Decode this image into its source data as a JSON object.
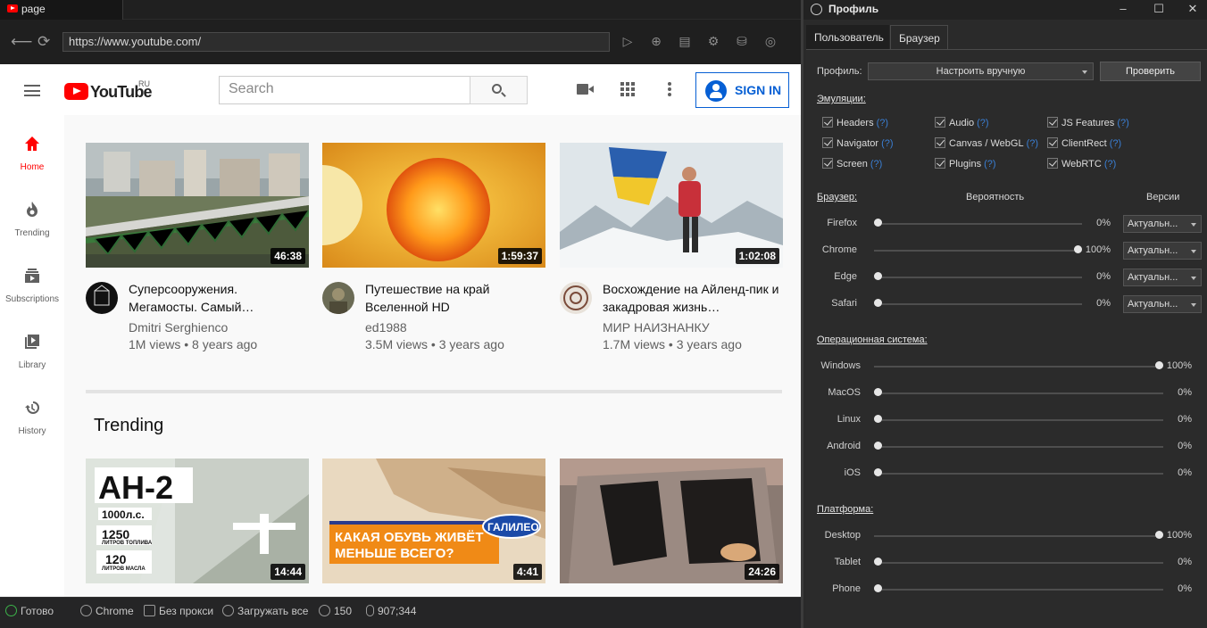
{
  "browser": {
    "tab_title": "page",
    "url": "https://www.youtube.com/"
  },
  "youtube": {
    "logo_text": "YouTube",
    "region": "RU",
    "search_placeholder": "Search",
    "sign_in": "SIGN IN",
    "guide": [
      "Home",
      "Trending",
      "Subscriptions",
      "Library",
      "History"
    ],
    "videos": [
      {
        "title": "Суперсооружения. Мегамосты. Самый…",
        "channel": "Dmitri Serghienco",
        "meta": "1M views • 8 years ago",
        "duration": "46:38"
      },
      {
        "title": "Путешествие на край Вселенной HD",
        "channel": "ed1988",
        "meta": "3.5M views • 3 years ago",
        "duration": "1:59:37"
      },
      {
        "title": "Восхождение на Айленд-пик и закадровая жизнь…",
        "channel": "МИР НАИЗНАНКУ",
        "meta": "1.7M views • 3 years ago",
        "duration": "1:02:08"
      }
    ],
    "trending_title": "Trending",
    "trending": [
      {
        "duration": "14:44",
        "overlay": [
          "АН-2",
          "1000л.с.",
          "1250",
          "ЛИТРОВ ТОПЛИВА",
          "120",
          "ЛИТРОВ МАСЛА"
        ]
      },
      {
        "duration": "4:41",
        "overlay": [
          "КАКАЯ ОБУВЬ ЖИВЁТ",
          "МЕНЬШЕ ВСЕГО?",
          "ГАЛИЛЕО"
        ]
      },
      {
        "duration": "24:26",
        "overlay": []
      }
    ]
  },
  "statusbar": {
    "state": "Готово",
    "browser": "Chrome",
    "proxy": "Без прокси",
    "load": "Загружать все",
    "count": "150",
    "coords": "907;344"
  },
  "panel": {
    "title": "Профиль",
    "tabs": [
      "Пользователь",
      "Браузер"
    ],
    "profile_label": "Профиль:",
    "profile_value": "Настроить вручную",
    "check_button": "Проверить",
    "emulation_label": "Эмуляции:",
    "emulations": [
      {
        "label": "Headers",
        "q": "(?)"
      },
      {
        "label": "Audio",
        "q": "(?)"
      },
      {
        "label": "JS Features",
        "q": "(?)"
      },
      {
        "label": "Navigator",
        "q": "(?)"
      },
      {
        "label": "Canvas / WebGL",
        "q": "(?)"
      },
      {
        "label": "ClientRect",
        "q": "(?)"
      },
      {
        "label": "Screen",
        "q": "(?)"
      },
      {
        "label": "Plugins",
        "q": "(?)"
      },
      {
        "label": "WebRTC",
        "q": "(?)"
      }
    ],
    "browser_label": "Браузер:",
    "probability_label": "Вероятность",
    "versions_label": "Версии",
    "browsers": [
      {
        "name": "Firefox",
        "value": 0,
        "pct": "0%",
        "version": "Актуальн..."
      },
      {
        "name": "Chrome",
        "value": 100,
        "pct": "100%",
        "version": "Актуальн..."
      },
      {
        "name": "Edge",
        "value": 0,
        "pct": "0%",
        "version": "Актуальн..."
      },
      {
        "name": "Safari",
        "value": 0,
        "pct": "0%",
        "version": "Актуальн..."
      }
    ],
    "os_label": "Операционная система:",
    "os": [
      {
        "name": "Windows",
        "value": 100,
        "pct": "100%"
      },
      {
        "name": "MacOS",
        "value": 0,
        "pct": "0%"
      },
      {
        "name": "Linux",
        "value": 0,
        "pct": "0%"
      },
      {
        "name": "Android",
        "value": 0,
        "pct": "0%"
      },
      {
        "name": "iOS",
        "value": 0,
        "pct": "0%"
      }
    ],
    "platform_label": "Платформа:",
    "platforms": [
      {
        "name": "Desktop",
        "value": 100,
        "pct": "100%"
      },
      {
        "name": "Tablet",
        "value": 0,
        "pct": "0%"
      },
      {
        "name": "Phone",
        "value": 0,
        "pct": "0%"
      }
    ]
  }
}
